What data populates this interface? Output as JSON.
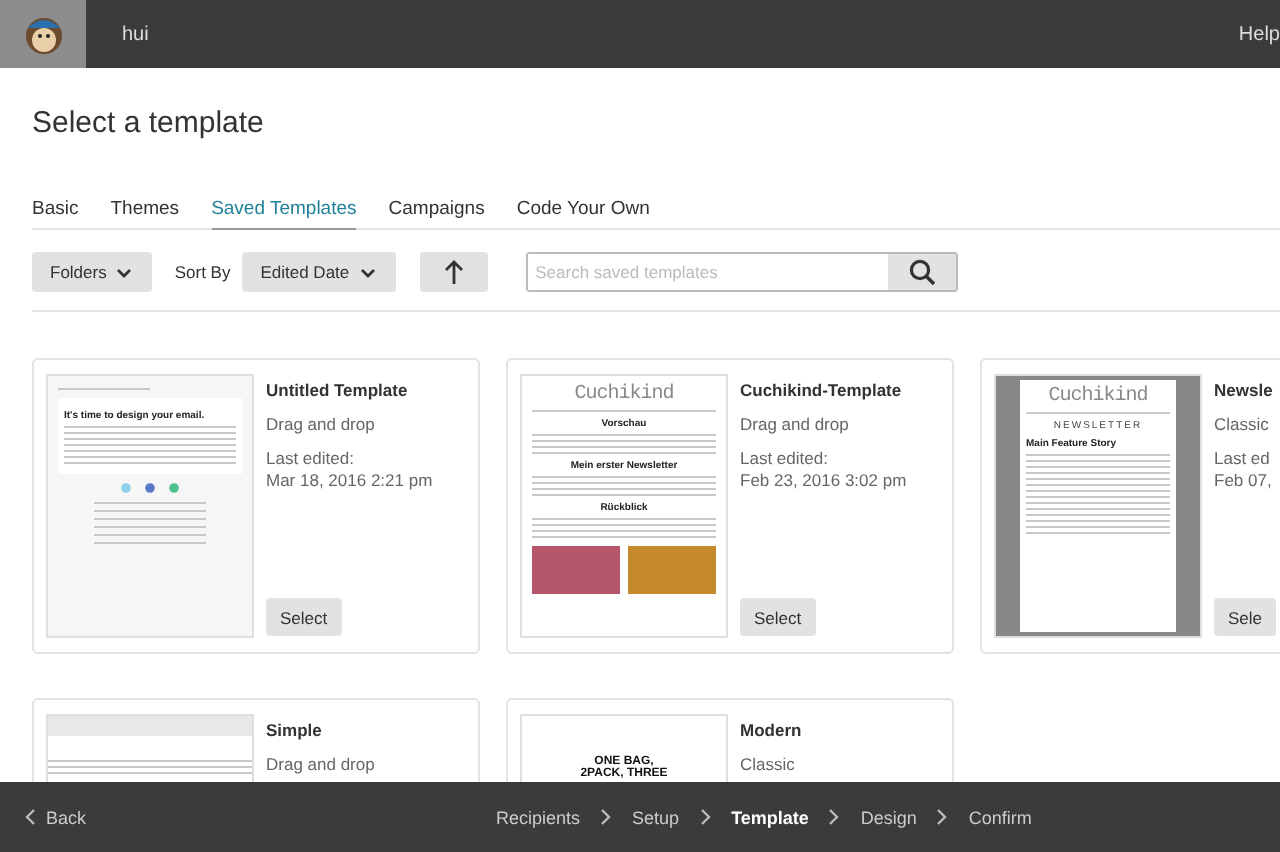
{
  "topbar": {
    "account": "hui",
    "help": "Help"
  },
  "title": "Select a template",
  "tabs": [
    {
      "label": "Basic",
      "selected": false
    },
    {
      "label": "Themes",
      "selected": false
    },
    {
      "label": "Saved Templates",
      "selected": true
    },
    {
      "label": "Campaigns",
      "selected": false
    },
    {
      "label": "Code Your Own",
      "selected": false
    }
  ],
  "toolbar": {
    "folders": "Folders",
    "sort_label": "Sort By",
    "sort": "Edited Date",
    "search": {
      "placeholder": "Search saved templates"
    }
  },
  "cards": [
    {
      "title": "Untitled Template",
      "type": "Drag and drop",
      "edited_label": "Last edited:",
      "edited": "Mar 18, 2016 2:21 pm",
      "button": "Select",
      "preview": {
        "kind": "basic",
        "texts": [
          "It's time to design your email."
        ]
      }
    },
    {
      "title": "Cuchikind-Template",
      "type": "Drag and drop",
      "edited_label": "Last edited:",
      "edited": "Feb 23, 2016 3:02 pm",
      "button": "Select",
      "preview": {
        "kind": "cuchikind",
        "texts": [
          "Cuchikind",
          "Vorschau",
          "Mein erster Newsletter",
          "Rückblick"
        ]
      }
    },
    {
      "title": "Newsle",
      "type": "Classic",
      "edited_label": "Last ed",
      "edited": "Feb 07,",
      "button": "Sele",
      "preview": {
        "kind": "newsletter",
        "texts": [
          "Cuchikind",
          "NEWSLETTER",
          "Main Feature Story"
        ]
      }
    },
    {
      "title": "Simple",
      "type": "Drag and drop",
      "preview": {
        "kind": "simple"
      }
    },
    {
      "title": "Modern",
      "type": "Classic",
      "preview": {
        "kind": "modern",
        "texts": [
          "ONE BAG,",
          "2PACK, THREE"
        ]
      }
    }
  ],
  "footer": {
    "back": "Back",
    "steps": [
      {
        "label": "Recipients",
        "selected": false
      },
      {
        "label": "Setup",
        "selected": false
      },
      {
        "label": "Template",
        "selected": true
      },
      {
        "label": "Design",
        "selected": false
      },
      {
        "label": "Confirm",
        "selected": false
      }
    ]
  }
}
